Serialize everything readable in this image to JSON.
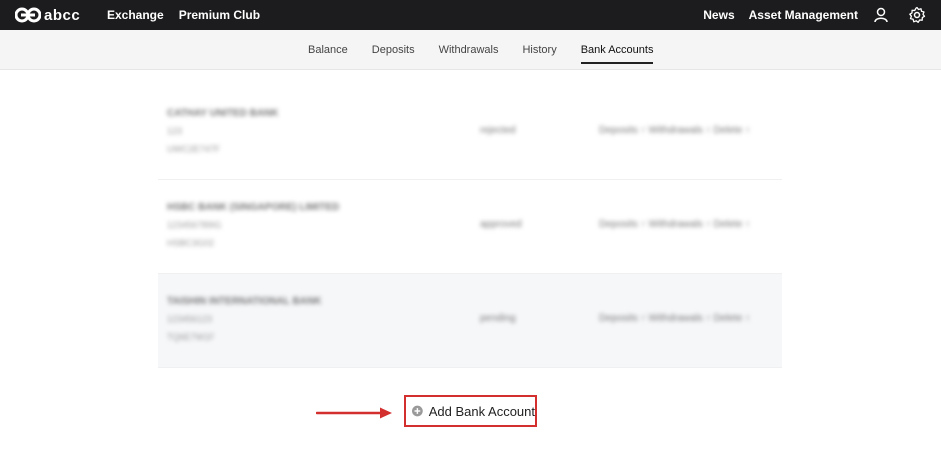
{
  "brand": {
    "name": "abcc"
  },
  "topnav": {
    "left_links": [
      "Exchange",
      "Premium Club"
    ],
    "right_links": [
      "News",
      "Asset Management"
    ],
    "icons": [
      "user-icon",
      "settings-gear-icon"
    ]
  },
  "subnav": {
    "tabs": [
      "Balance",
      "Deposits",
      "Withdrawals",
      "History",
      "Bank Accounts"
    ],
    "active": "Bank Accounts"
  },
  "accounts": [
    {
      "name": "CATHAY UNITED BANK",
      "line2": "123",
      "line3": "UWC2E747F",
      "status": "rejected",
      "actions": "Deposits ↑ Withdrawals ↑ Delete ↑"
    },
    {
      "name": "HSBC BANK (SINGAPORE) LIMITED",
      "line2": "123456789IG",
      "line3": "HSBC3G02",
      "status": "approved",
      "actions": "Deposits ↑ Withdrawals ↑ Delete ↑"
    },
    {
      "name": "TAISHIN INTERNATIONAL BANK",
      "line2": "123456123",
      "line3": "TQ6E7W1F",
      "status": "pending",
      "actions": "Deposits ↑ Withdrawals ↑ Delete ↑"
    }
  ],
  "add_button": {
    "label": "Add Bank Account",
    "icon": "plus-circle-icon"
  },
  "annotation": {
    "icon": "red-arrow-icon",
    "color": "#d32f2f"
  }
}
